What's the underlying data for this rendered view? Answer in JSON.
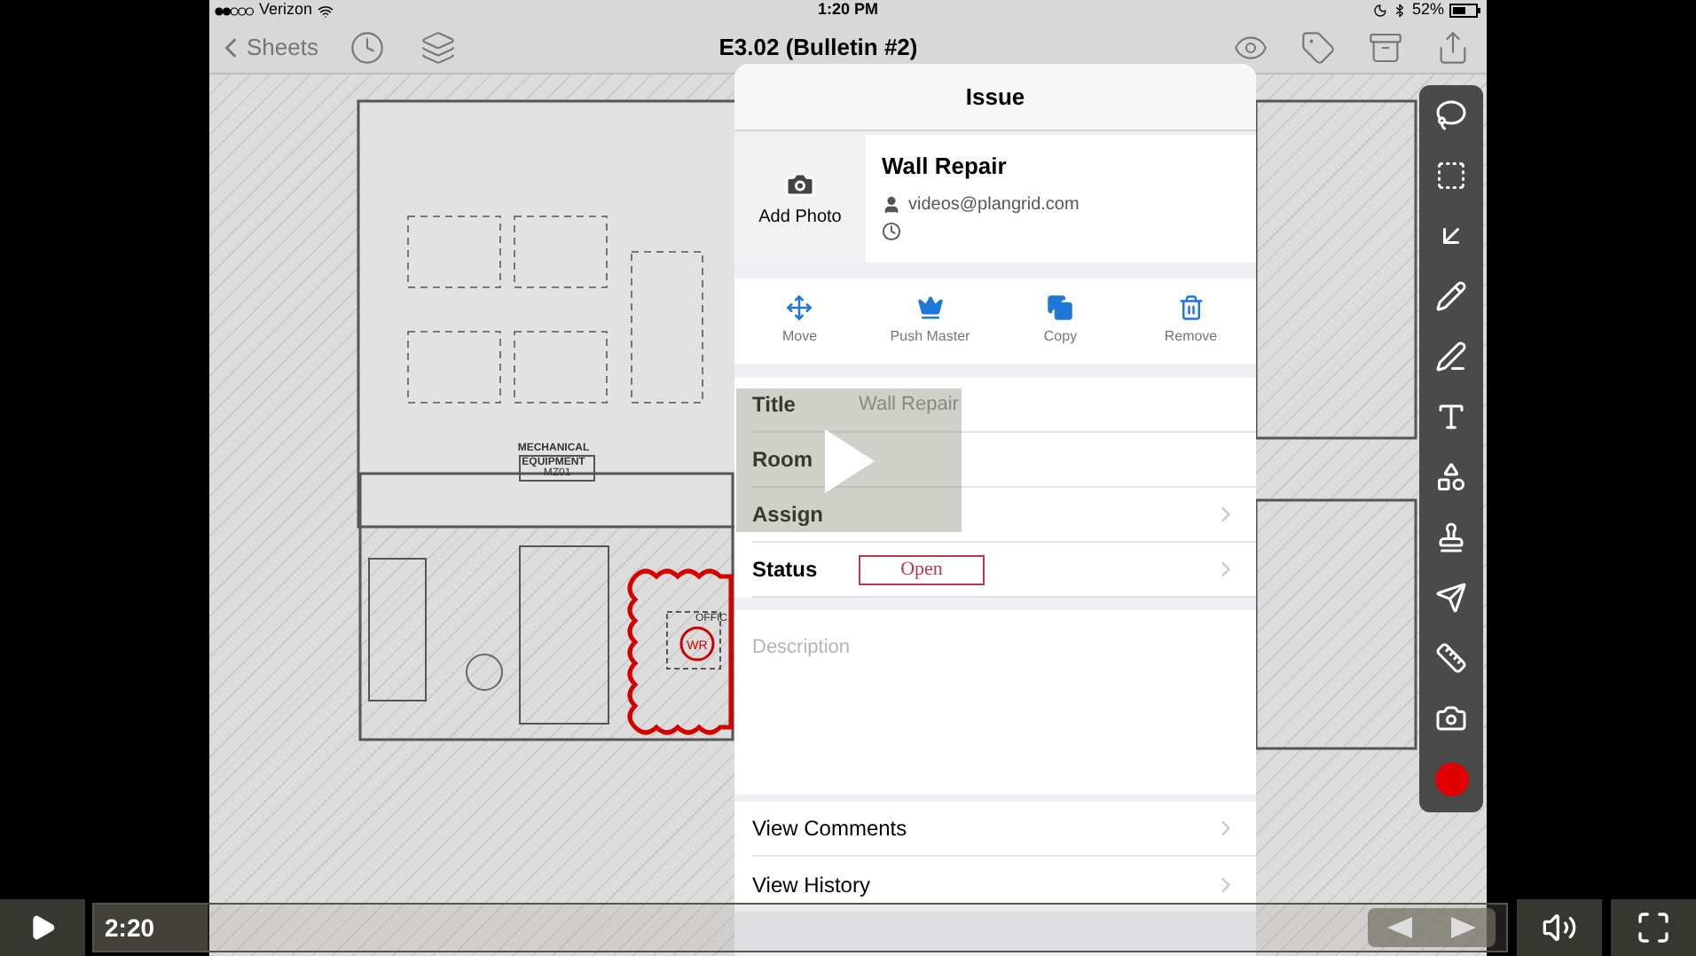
{
  "status_bar": {
    "carrier": "Verizon",
    "time": "1:20 PM",
    "battery": "52%"
  },
  "nav_bar": {
    "back": "Sheets",
    "title": "E3.02 (Bulletin #2)"
  },
  "sheet": {
    "room_name": [
      "MECHANICAL",
      "EQUIPMENT"
    ],
    "room_tag": "MZ01",
    "markup_tag": "WR",
    "cut_label": "OFFIC"
  },
  "issue": {
    "header": "Issue",
    "photo_button": "Add Photo",
    "title": "Wall Repair",
    "author": "videos@plangrid.com",
    "actions": [
      {
        "label": "Move"
      },
      {
        "label": "Push Master"
      },
      {
        "label": "Copy"
      },
      {
        "label": "Remove"
      }
    ],
    "fields": [
      {
        "label": "Title",
        "value": "Wall Repair",
        "kind": "text",
        "chevron": false
      },
      {
        "label": "Room",
        "kind": "text",
        "chevron": false
      },
      {
        "label": "Assign",
        "kind": "text",
        "chevron": true
      },
      {
        "label": "Status",
        "value": "Open",
        "kind": "status",
        "chevron": true
      }
    ],
    "description_placeholder": "Description",
    "links": [
      "View Comments",
      "View History"
    ]
  },
  "player": {
    "time": "2:20",
    "level": 0.08
  }
}
